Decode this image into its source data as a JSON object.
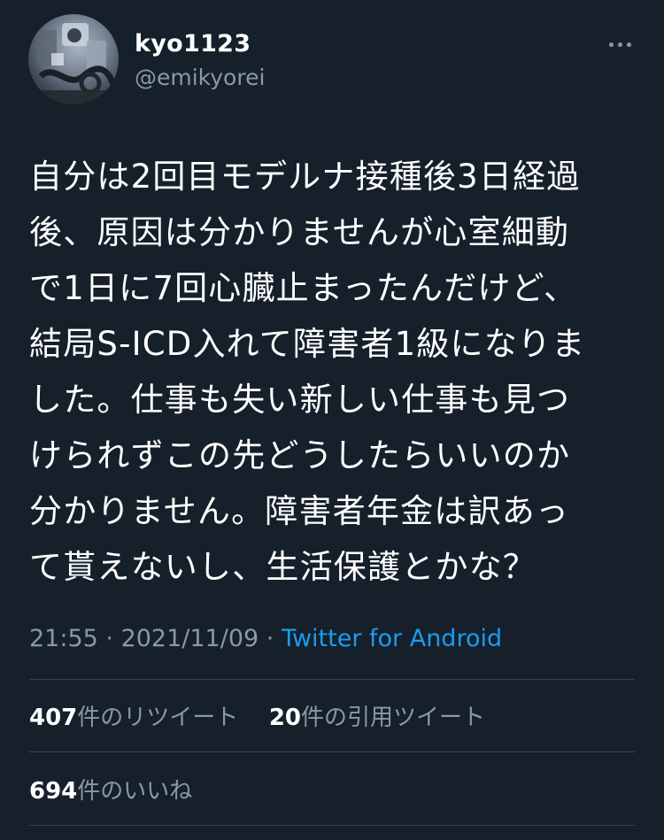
{
  "tweet": {
    "author": {
      "display_name": "kyo1123",
      "handle": "@emikyorei",
      "avatar_icon": "avatar-photo"
    },
    "more_icon": "more-horizontal-icon",
    "text_lines": [
      "自分は2回目モデルナ接種後3日経過",
      "後、原因は分かりませんが心室細動",
      "で1日に7回心臓止まったんだけど、",
      "結局S-ICD入れて障害者1級になりま",
      "した。仕事も失い新しい仕事も見つ",
      "けられずこの先どうしたらいいのか",
      "分かりません。障害者年金は訳あっ",
      "て貰えないし、生活保護とかな？"
    ],
    "time": "21:55",
    "separator": " · ",
    "date": "2021/11/09",
    "source": "Twitter for Android",
    "stats": {
      "retweets_count": "407",
      "retweets_label": "件のリツイート",
      "quotes_count": "20",
      "quotes_label": "件の引用ツイート",
      "likes_count": "694",
      "likes_label": "件のいいね"
    }
  },
  "colors": {
    "background": "#15202b",
    "text_primary": "#ffffff",
    "text_secondary": "#8b98a5",
    "link": "#1d9bf0",
    "divider": "#38444d"
  }
}
